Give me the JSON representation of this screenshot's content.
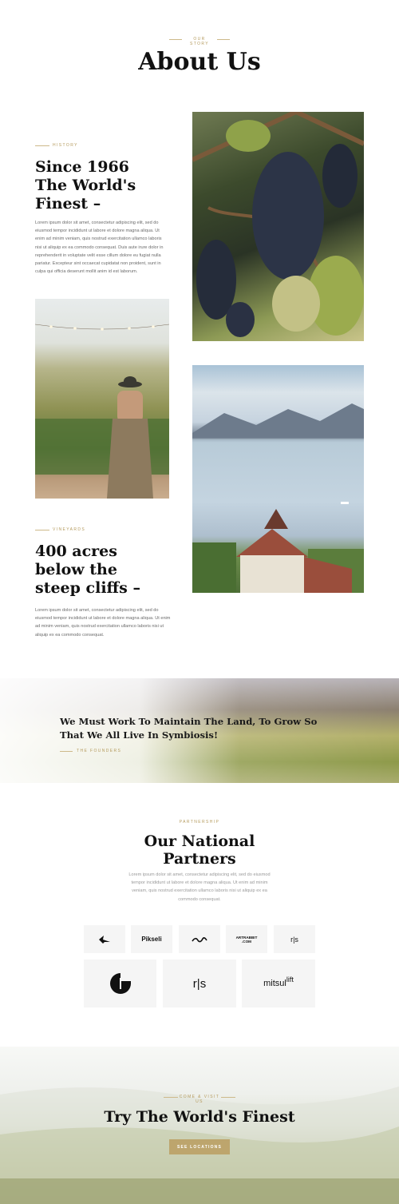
{
  "header": {
    "eyebrow": "OUR STORY",
    "title": "About Us"
  },
  "history": {
    "eyebrow": "HISTORY",
    "title_lines": [
      "Since 1966",
      "The World's",
      "Finest –"
    ],
    "body": "Lorem ipsum dolor sit amet, consectetur adipiscing elit, sed do eiusmod tempor incididunt ut labore et dolore magna aliqua. Ut enim ad minim veniam, quis nostrud exercitation ullamco laboris nisi ut aliquip ex ea commodo consequat. Duis aute irure dolor in reprehenderit in voluptate velit esse cillum dolore eu fugiat nulla pariatur. Excepteur sint occaecat cupidatat non proident, sunt in culpa qui officia deserunt mollit anim id est laborum."
  },
  "vineyards": {
    "eyebrow": "VINEYARDS",
    "title_lines": [
      "400 acres",
      "below the",
      "steep cliffs –"
    ],
    "body": "Lorem ipsum dolor sit amet, consectetur adipiscing elit, sed do eiusmod tempor incididunt ut labore et dolore magna aliqua. Ut enim ad minim veniam, quis nostrud exercitation ullamco laboris nisi ut aliquip ex ea commodo consequat."
  },
  "quote": {
    "text_lines": [
      "We Must Work To Maintain The Land, To Grow So",
      "That We All Live In Symbiosis!"
    ],
    "attribution": "THE FOUNDERS"
  },
  "partners": {
    "eyebrow": "PARTNERSHIP",
    "title_lines": [
      "Our National",
      "Partners"
    ],
    "body": "Lorem ipsum dolor sit amet, consectetur adipiscing elit, sed do eiusmod tempor incididunt ut labore et dolore magna aliqua. Ut enim ad minim veniam, quis nostrud exercitation ullamco laboris nisi ut aliquip ex ea commodo consequat.",
    "logos": {
      "pikseli": "Pikseli",
      "artrabbit_line1": "ARTRABBIT",
      "artrabbit_line2": ".COM",
      "rs": "r|s",
      "mitsul": "mitsul",
      "lift": "lift"
    }
  },
  "cta": {
    "eyebrow": "COME & VISIT US",
    "title": "Try The World's Finest",
    "button_label": "SEE LOCATIONS"
  },
  "colors": {
    "accent": "#bda56d",
    "eyebrow": "#b59b5e",
    "logo_bg": "#f5f5f5"
  }
}
